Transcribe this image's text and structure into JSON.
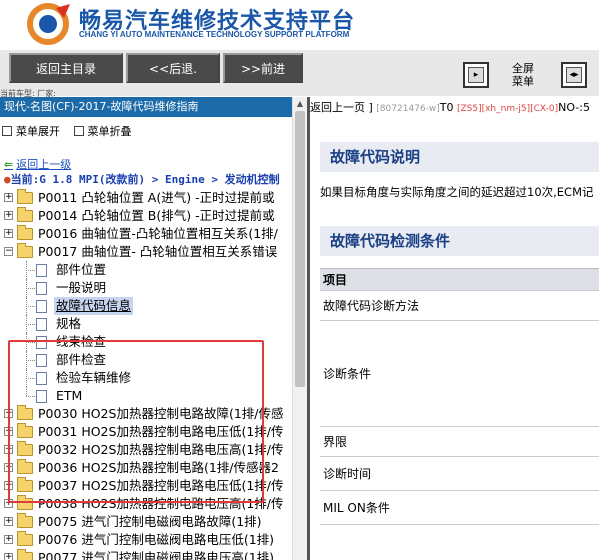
{
  "header": {
    "title_cn": "畅易汽车维修技术支持平台",
    "title_en": "CHANG YI AUTO MAINTENANCE TECHNOLOGY SUPPORT PLATFORM",
    "brand_color": "#1a57a8"
  },
  "toolbar": {
    "home_label": "返回主目录",
    "back_label": "<<后退.",
    "forward_label": ">>前进",
    "fullscreen_label_1": "全屏",
    "fullscreen_label_2": "菜单"
  },
  "vehicle_line": "当前车型: 厂家:",
  "left": {
    "title": "现代-名图(CF)-2017-故障代码维修指南",
    "expand_all": "菜单展开",
    "collapse_all": "菜单折叠",
    "back_link": "返回上一级",
    "current_path": "当前:G 1.8 MPI(改款前) > Engine > 发动机控制",
    "tree": [
      {
        "label": "P0011 凸轮轴位置 A(进气) -正时过提前或",
        "type": "folder"
      },
      {
        "label": "P0014 凸轮轴位置 B(排气) -正时过提前或",
        "type": "folder"
      },
      {
        "label": "P0016 曲轴位置-凸轮轴位置相互关系(1排/",
        "type": "folder"
      },
      {
        "label": "P0017 曲轴位置- 凸轮轴位置相互关系错误",
        "type": "folder",
        "expanded": true
      },
      {
        "label": "部件位置",
        "type": "page"
      },
      {
        "label": "一般说明",
        "type": "page"
      },
      {
        "label": "故障代码信息",
        "type": "page",
        "selected": true
      },
      {
        "label": "规格",
        "type": "page"
      },
      {
        "label": "线束检查",
        "type": "page"
      },
      {
        "label": "部件检查",
        "type": "page"
      },
      {
        "label": "检验车辆维修",
        "type": "page"
      },
      {
        "label": "ETM",
        "type": "page"
      },
      {
        "label": "P0030 HO2S加热器控制电路故障(1排/传感",
        "type": "folder"
      },
      {
        "label": "P0031 HO2S加热器控制电路电压低(1排/传",
        "type": "folder"
      },
      {
        "label": "P0032 HO2S加热器控制电路电压高(1排/传",
        "type": "folder"
      },
      {
        "label": "P0036 HO2S加热器控制电路(1排/传感器2",
        "type": "folder"
      },
      {
        "label": "P0037 HO2S加热器控制电路电压低(1排/传",
        "type": "folder"
      },
      {
        "label": "P0038 HO2S加热器控制电路电压高(1排/传",
        "type": "folder"
      },
      {
        "label": "P0075 进气门控制电磁阀电路故障(1排)",
        "type": "folder"
      },
      {
        "label": "P0076 进气门控制电磁阀电路电压低(1排)",
        "type": "folder"
      },
      {
        "label": "P0077 进气门控制电磁阀电路电压高(1排)",
        "type": "folder"
      }
    ]
  },
  "right": {
    "crumb_prefix": "返回上一页 ]",
    "crumb_grey_1": "[80721476-w]",
    "crumb_t0": "T0",
    "crumb_grey_2": "[ZS5][xh_nm-j5][CX-0]",
    "crumb_tail": "NO-:5",
    "section1_title": "故障代码说明",
    "description": "如果目标角度与实际角度之间的延迟超过10次,ECM记",
    "section2_title": "故障代码检测条件",
    "table_header": "项目",
    "table_rows": [
      "故障代码诊断方法",
      "诊断条件",
      "界限",
      "诊断时间",
      "MIL ON条件"
    ]
  }
}
